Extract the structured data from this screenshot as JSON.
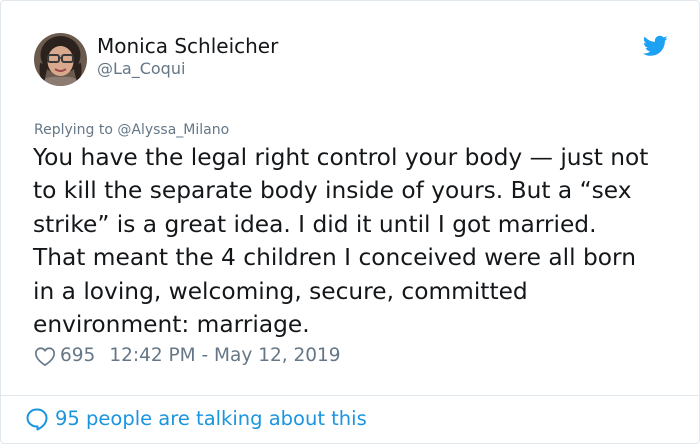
{
  "author": {
    "display_name": "Monica Schleicher",
    "handle": "@La_Coqui"
  },
  "icons": {
    "brand": "twitter-bird-icon",
    "like": "heart-icon",
    "conversation": "speech-bubble-icon"
  },
  "reply": {
    "prefix": "Replying to",
    "to_handle": "@Alyssa_Milano"
  },
  "tweet": {
    "lines": [
      "You have the legal right control your body — just not",
      "to kill the separate body inside of yours. But a “sex",
      "strike” is a great idea. I did it until I got married.",
      "That meant the 4 children I conceived were all born",
      "in a loving, welcoming, secure, committed",
      "environment: marriage."
    ]
  },
  "meta": {
    "likes": "695",
    "timestamp": "12:42 PM - May 12, 2019"
  },
  "footer": {
    "label": "95 people are talking about this"
  },
  "colors": {
    "accent": "#1b95e0",
    "bird": "#1da1f2",
    "text": "#14171a",
    "muted": "#657786",
    "border": "#e1e8ed"
  }
}
